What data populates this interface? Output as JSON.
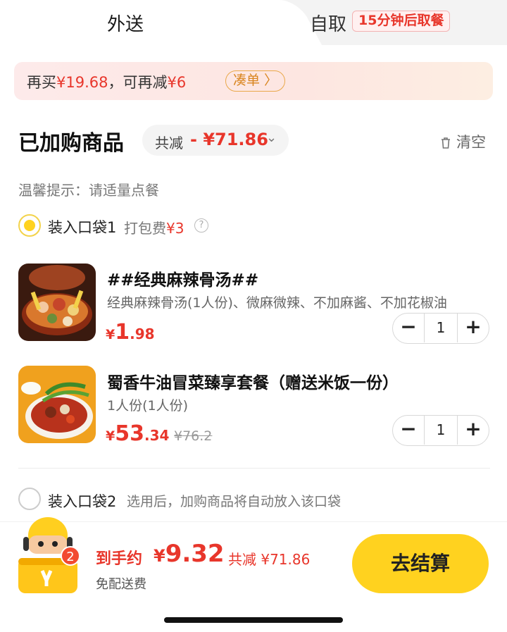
{
  "tabs": {
    "delivery": "外送",
    "pickup": "自取",
    "pickup_badge": "15分钟后取餐"
  },
  "promo": {
    "text_prefix": "再买",
    "amount_more": "¥19.68",
    "text_mid": "，可再减",
    "amount_off": "¥6",
    "button": "凑单 〉"
  },
  "cart": {
    "title": "已加购商品",
    "discount_label": "共减",
    "discount_value": "- ¥71.86",
    "clear": "清空",
    "tip": "温馨提示：请适量点餐"
  },
  "bag1": {
    "label": "装入口袋1",
    "fee_label": "打包费",
    "fee_value": "¥3",
    "selected": true
  },
  "items": [
    {
      "title": "##经典麻辣骨汤##",
      "desc": "经典麻辣骨汤(1人份)、微麻微辣、不加麻酱、不加花椒油",
      "currency": "¥",
      "price_int": "1",
      "price_dec": ".98",
      "original": "",
      "qty": "1"
    },
    {
      "title": "蜀香牛油冒菜臻享套餐（赠送米饭一份）",
      "desc": "1人份(1人份)",
      "currency": "¥",
      "price_int": "53",
      "price_dec": ".34",
      "original": "¥76.2",
      "qty": "1"
    }
  ],
  "bag2": {
    "label": "装入口袋2",
    "hint": "选用后，加购商品将自动放入该口袋",
    "selected": false
  },
  "footer": {
    "count": "2",
    "total_label": "到手约",
    "total_currency": "¥",
    "total_value": "9.32",
    "saved": "共减 ¥71.86",
    "free_shipping": "免配送费",
    "checkout": "去结算"
  },
  "colors": {
    "accent_red": "#e8362b",
    "accent_yellow": "#ffd21f"
  }
}
